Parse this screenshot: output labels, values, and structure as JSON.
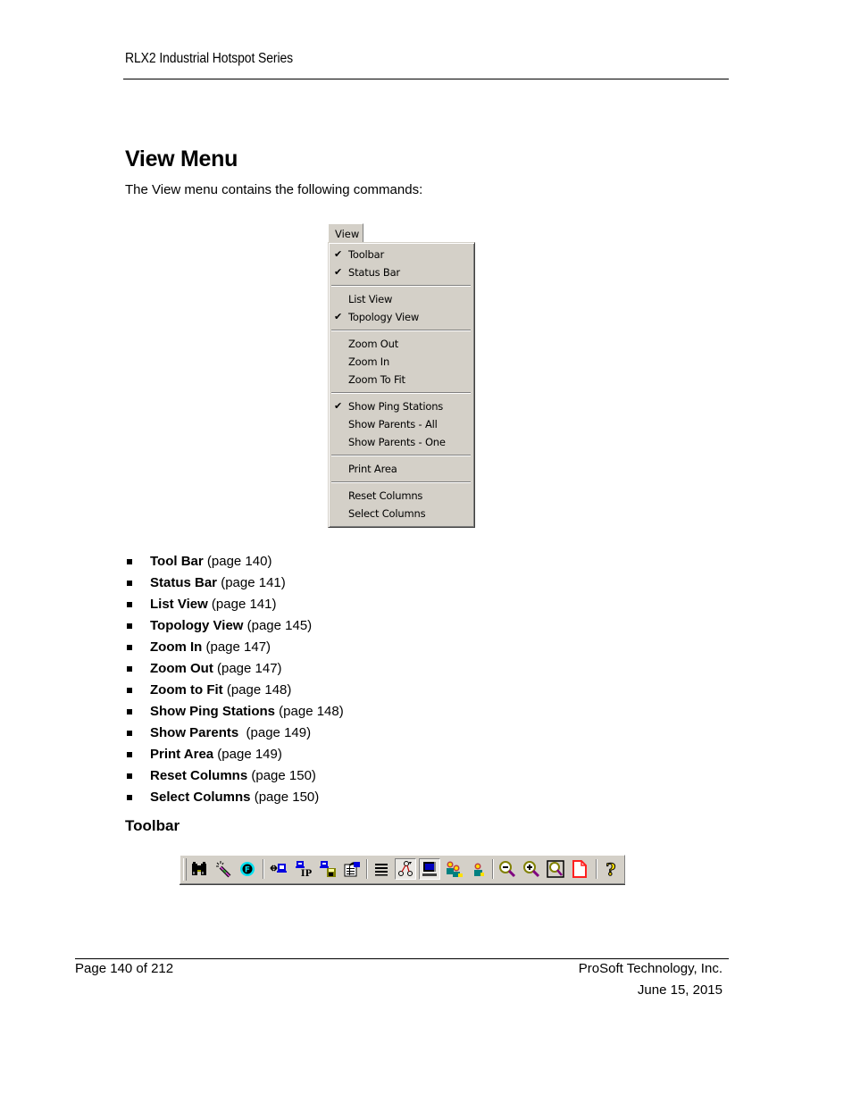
{
  "header": {
    "running_title": "RLX2 Industrial Hotspot Series"
  },
  "section": {
    "title": "View Menu",
    "intro": "The View menu contains the following commands:"
  },
  "menu": {
    "label": "View",
    "items": [
      {
        "label": "Toolbar",
        "checked": true,
        "check": "✔"
      },
      {
        "label": "Status Bar",
        "checked": true,
        "check": "✔"
      },
      {
        "label": "List View",
        "checked": false,
        "check": ""
      },
      {
        "label": "Topology View",
        "checked": true,
        "check": "✔"
      },
      {
        "label": "Zoom Out",
        "checked": false,
        "check": ""
      },
      {
        "label": "Zoom In",
        "checked": false,
        "check": ""
      },
      {
        "label": "Zoom To Fit",
        "checked": false,
        "check": ""
      },
      {
        "label": "Show Ping Stations",
        "checked": true,
        "check": "✔"
      },
      {
        "label": "Show Parents - All",
        "checked": false,
        "check": ""
      },
      {
        "label": "Show Parents - One",
        "checked": false,
        "check": ""
      },
      {
        "label": "Print Area",
        "checked": false,
        "check": ""
      },
      {
        "label": "Reset Columns",
        "checked": false,
        "check": ""
      },
      {
        "label": "Select Columns",
        "checked": false,
        "check": ""
      }
    ]
  },
  "commands": [
    {
      "name": "Tool Bar",
      "ref": " (page 140)"
    },
    {
      "name": "Status Bar",
      "ref": " (page 141)"
    },
    {
      "name": "List View",
      "ref": " (page 141)"
    },
    {
      "name": "Topology View",
      "ref": " (page 145)"
    },
    {
      "name": "Zoom In",
      "ref": " (page 147)"
    },
    {
      "name": "Zoom Out",
      "ref": " (page 147)"
    },
    {
      "name": "Zoom to Fit",
      "ref": " (page 148)"
    },
    {
      "name": "Show Ping Stations",
      "ref": " (page 148)"
    },
    {
      "name": "Show Parents",
      "ref": "  (page 149)"
    },
    {
      "name": "Print Area",
      "ref": " (page 149)"
    },
    {
      "name": "Reset Columns",
      "ref": " (page 150)"
    },
    {
      "name": "Select Columns",
      "ref": " (page 150)"
    }
  ],
  "toolbar_section": {
    "heading": "Toolbar",
    "buttons": [
      "find-icon",
      "scan-icon",
      "f-icon",
      "connect-icon",
      "ip-icon",
      "save-icon",
      "properties-icon",
      "list-view-icon",
      "topology-view-icon",
      "monitor-icon",
      "show-parents-all-icon",
      "show-parents-one-icon",
      "zoom-out-icon",
      "zoom-in-icon",
      "zoom-to-fit-icon",
      "print-area-icon",
      "help-icon"
    ]
  },
  "colors": {
    "menu_face": "#d4d0c8",
    "shadow": "#808080",
    "print_red": "#ff2020",
    "ip_blue": "#0000c0"
  },
  "footer": {
    "page": "Page 140 of 212",
    "company": "ProSoft Technology, Inc.",
    "date": "June 15, 2015"
  }
}
